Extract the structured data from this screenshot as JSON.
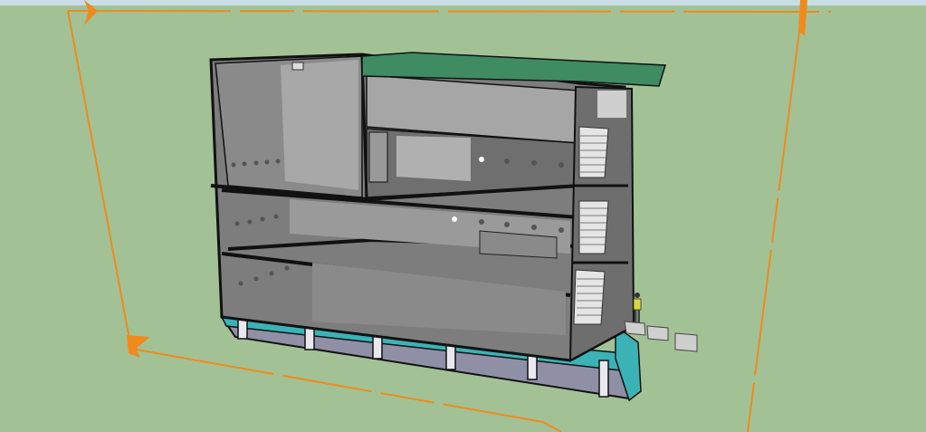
{
  "app": {
    "view": "3d-model-viewport",
    "sky_color": "#c9dde6",
    "ground_color": "#a2c296",
    "section_plane_color": "#f08a1c",
    "wall_color": "#7d7d7d",
    "wall_light_color": "#a8a8a8",
    "roof_color": "#3f8b62",
    "glass_band_color": "#3bb3b6",
    "base_color": "#8f8fa6"
  },
  "icons": {
    "section_plane_marker": "section-plane-arrow-icon",
    "human_figure": "scale-figure-icon"
  }
}
